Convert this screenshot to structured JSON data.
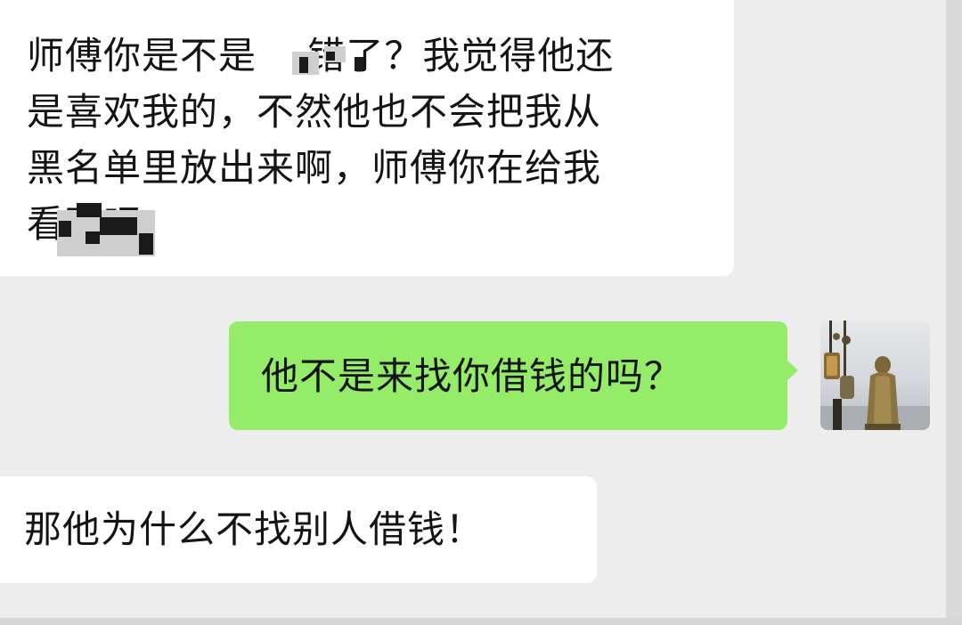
{
  "chat": {
    "messages": [
      {
        "direction": "incoming",
        "lines": [
          "师傅你是不是    错了？我觉得他还",
          "是喜欢我的，不然他也不会把我从",
          "黑名单里放出来啊，师傅你在给我",
          "看下吧"
        ]
      },
      {
        "direction": "outgoing",
        "lines": [
          "他不是来找你借钱的吗？"
        ]
      },
      {
        "direction": "incoming",
        "lines": [
          "那他为什么不找别人借钱！"
        ]
      }
    ],
    "colors": {
      "background": "#ededed",
      "incoming_bubble": "#ffffff",
      "outgoing_bubble": "#95ec69",
      "text": "#141414"
    },
    "avatar_icon": "buddha-statue-avatar-icon"
  }
}
